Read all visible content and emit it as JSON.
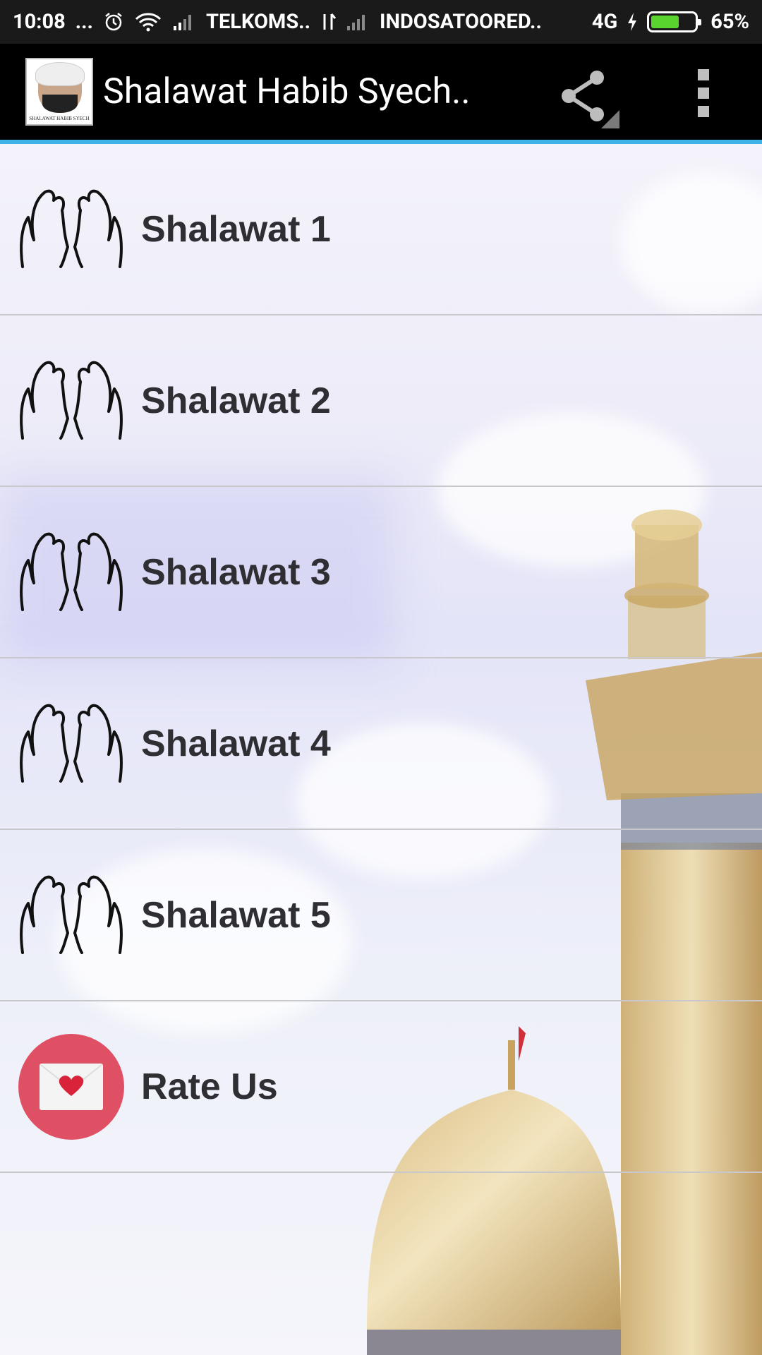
{
  "status_bar": {
    "time": "10:08",
    "dots": "...",
    "carrier1": "TELKOMS..",
    "carrier2": "INDOSATOORED..",
    "network": "4G",
    "battery_pct": "65%",
    "battery_level": 0.65,
    "battery_color": "#59d32e"
  },
  "action_bar": {
    "title": "Shalawat Habib Syech..",
    "logo_caption": "SHALAWAT HABIB SYECH",
    "accent_color": "#3fb2e8"
  },
  "menu": {
    "items": [
      {
        "label": "Shalawat 1",
        "icon": "praying-hands-icon"
      },
      {
        "label": "Shalawat 2",
        "icon": "praying-hands-icon"
      },
      {
        "label": "Shalawat 3",
        "icon": "praying-hands-icon"
      },
      {
        "label": "Shalawat 4",
        "icon": "praying-hands-icon"
      },
      {
        "label": "Shalawat 5",
        "icon": "praying-hands-icon"
      },
      {
        "label": "Rate Us",
        "icon": "heart-envelope-icon"
      }
    ]
  },
  "colors": {
    "rate_circle": "#e05064",
    "heart": "#d8233a"
  }
}
